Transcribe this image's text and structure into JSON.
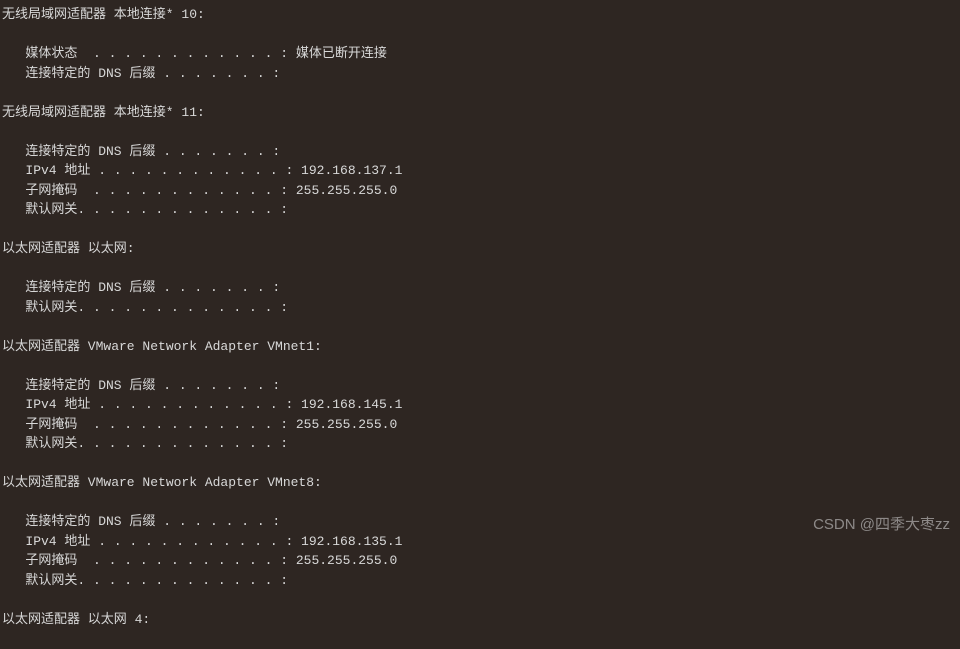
{
  "adapters": [
    {
      "header": "无线局域网适配器 本地连接* 10:",
      "lines": [
        "   媒体状态  . . . . . . . . . . . . : 媒体已断开连接",
        "   连接特定的 DNS 后缀 . . . . . . . :"
      ]
    },
    {
      "header": "无线局域网适配器 本地连接* 11:",
      "lines": [
        "   连接特定的 DNS 后缀 . . . . . . . :",
        "   IPv4 地址 . . . . . . . . . . . . : 192.168.137.1",
        "   子网掩码  . . . . . . . . . . . . : 255.255.255.0",
        "   默认网关. . . . . . . . . . . . . :"
      ]
    },
    {
      "header": "以太网适配器 以太网:",
      "lines": [
        "   连接特定的 DNS 后缀 . . . . . . . :",
        "   默认网关. . . . . . . . . . . . . :"
      ]
    },
    {
      "header": "以太网适配器 VMware Network Adapter VMnet1:",
      "lines": [
        "   连接特定的 DNS 后缀 . . . . . . . :",
        "   IPv4 地址 . . . . . . . . . . . . : 192.168.145.1",
        "   子网掩码  . . . . . . . . . . . . : 255.255.255.0",
        "   默认网关. . . . . . . . . . . . . :"
      ]
    },
    {
      "header": "以太网适配器 VMware Network Adapter VMnet8:",
      "lines": [
        "   连接特定的 DNS 后缀 . . . . . . . :",
        "   IPv4 地址 . . . . . . . . . . . . : 192.168.135.1",
        "   子网掩码  . . . . . . . . . . . . : 255.255.255.0",
        "   默认网关. . . . . . . . . . . . . :"
      ]
    },
    {
      "header": "以太网适配器 以太网 4:",
      "lines": []
    }
  ],
  "watermark": "CSDN @四季大枣zz"
}
